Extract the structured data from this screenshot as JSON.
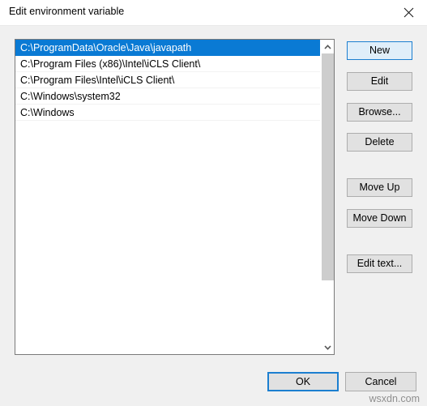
{
  "window": {
    "title": "Edit environment variable",
    "close_icon": "close-icon"
  },
  "listbox": {
    "selected_index": 0,
    "items": [
      "C:\\ProgramData\\Oracle\\Java\\javapath",
      "C:\\Program Files (x86)\\Intel\\iCLS Client\\",
      "C:\\Program Files\\Intel\\iCLS Client\\",
      "C:\\Windows\\system32",
      "C:\\Windows"
    ],
    "scrollbar": {
      "up_arrow_icon": "chevron-up-icon",
      "down_arrow_icon": "chevron-down-icon"
    }
  },
  "side_buttons": [
    {
      "label": "New",
      "focused": true
    },
    {
      "label": "Edit",
      "focused": false
    },
    {
      "label": "Browse...",
      "focused": false
    },
    {
      "label": "Delete",
      "focused": false
    },
    {
      "label": "Move Up",
      "focused": false
    },
    {
      "label": "Move Down",
      "focused": false
    },
    {
      "label": "Edit text...",
      "focused": false
    }
  ],
  "footer": {
    "ok_label": "OK",
    "cancel_label": "Cancel"
  },
  "watermark": "wsxdn.com",
  "colors": {
    "selection_blue": "#0a7ad4",
    "focus_blue": "#1c7fd0",
    "dialog_bg": "#f0f0f0",
    "button_face": "#e1e1e1",
    "button_border": "#adadad",
    "listbox_border": "#7a7a7a",
    "scroll_thumb": "#cdcdcd",
    "watermark_gray": "#8f8f8f"
  }
}
